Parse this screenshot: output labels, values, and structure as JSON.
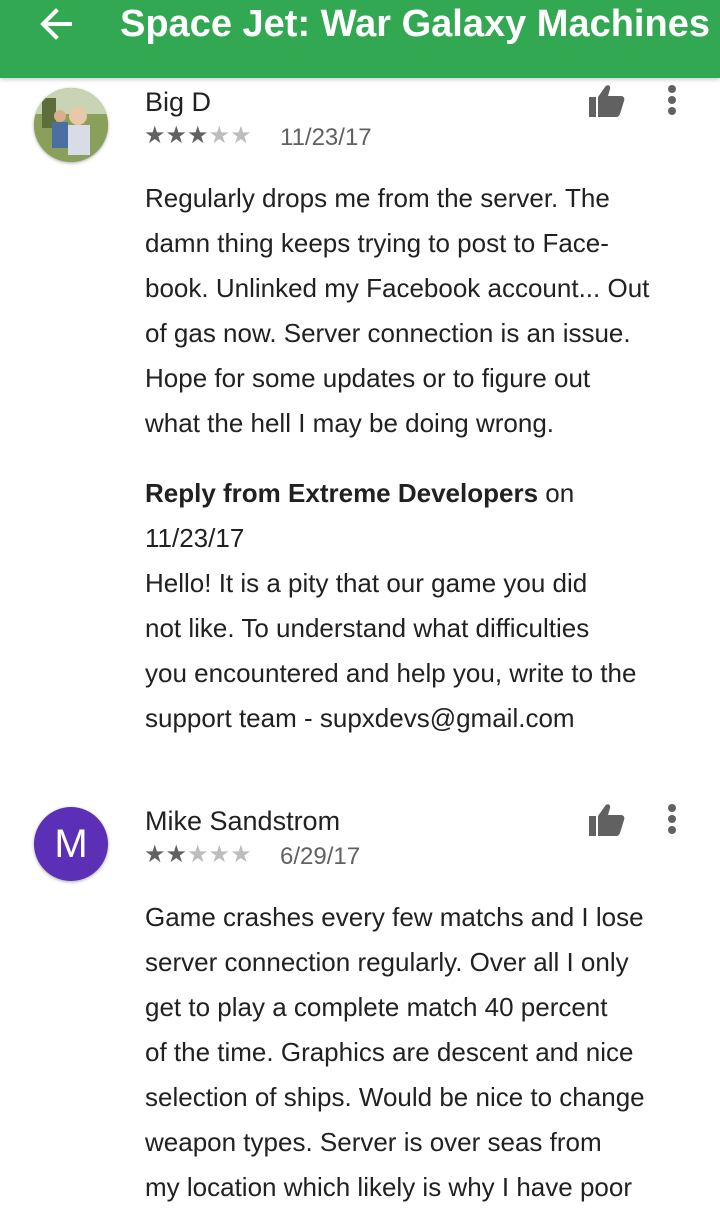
{
  "appbar": {
    "title": "Space Jet: War Galaxy Machines",
    "back_icon": "arrow-left-icon",
    "color": "#33a852"
  },
  "reviews": [
    {
      "author": "Big D",
      "avatar_type": "photo",
      "rating": 3,
      "max_rating": 5,
      "date": "11/23/17",
      "text": "Regularly drops me from the server. The damn thing keeps trying to post to Face-book. Unlinked my Facebook account... Out of gas now. Server connection is an issue. Hope for some updates or to figure out what the hell I may be doing wrong.",
      "text_lines": [
        "Regularly drops me from the server. The",
        "damn thing keeps trying to post to Face-",
        "book. Unlinked my Facebook account... Out",
        "of gas now. Server connection is an issue.",
        "Hope for some updates or to figure out",
        "what the hell I may be doing wrong."
      ],
      "reply": {
        "from_label": "Reply from Extreme Developers",
        "on_word": "on",
        "date": "11/23/17",
        "text_lines": [
          "Hello! It is a pity that our game you did",
          "not like. To understand what difficulties",
          "you encountered and help you, write to the",
          "support team - supxdevs@gmail.com"
        ]
      }
    },
    {
      "author": "Mike Sandstrom",
      "avatar_type": "letter",
      "avatar_letter": "M",
      "avatar_color": "#5b2fb6",
      "rating": 2,
      "max_rating": 5,
      "date": "6/29/17",
      "text_lines": [
        "Game crashes every few matchs and I lose",
        "server connection regularly. Over all I only",
        "get to play a complete match 40 percent",
        "of the time. Graphics are descent and nice",
        "selection of ships. Would be nice to change",
        "weapon types. Server is over seas from",
        "my location which likely is why I have poor"
      ]
    }
  ]
}
